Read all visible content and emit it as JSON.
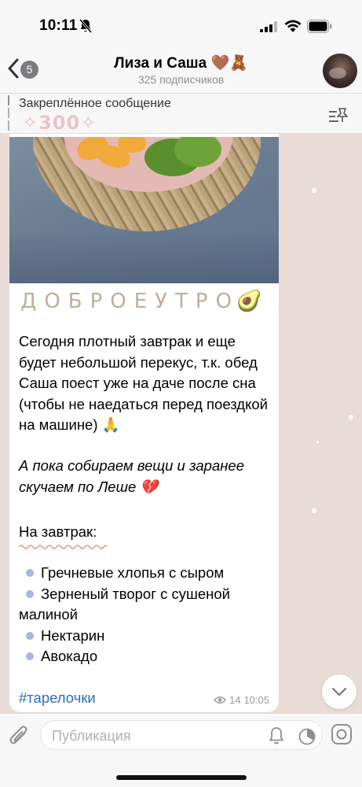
{
  "status_bar": {
    "time": "10:11"
  },
  "header": {
    "back_count": "5",
    "title": "Лиза и Саша 🤎🧸",
    "subtitle": "325 подписчиков"
  },
  "pinned": {
    "label": "Закреплённое сообщение",
    "preview": "✧300✧"
  },
  "message": {
    "headline": "ДОБРОЕУТРО",
    "headline_emoji": "🥑",
    "paragraph1": "Сегодня плотный завтрак и еще будет небольшой перекус, т.к. обед Саша поест уже на даче после сна (чтобы не наедаться перед поездкой на машине) 🙏",
    "paragraph2": "А пока собираем вещи и заранее скучаем по Леше 💔",
    "list_title": "На завтрак:",
    "items": [
      "Гречневые хлопья с сыром",
      "Зерненый творог с сушеной малиной",
      "Нектарин",
      "Авокадо"
    ],
    "hashtag": "#тарелочки",
    "views": "14",
    "time": "10:05"
  },
  "input": {
    "placeholder": "Публикация"
  },
  "colors": {
    "accent": "#2f6db5",
    "bullet": "#a9b7df",
    "chat_bg": "#e9dcd6"
  }
}
